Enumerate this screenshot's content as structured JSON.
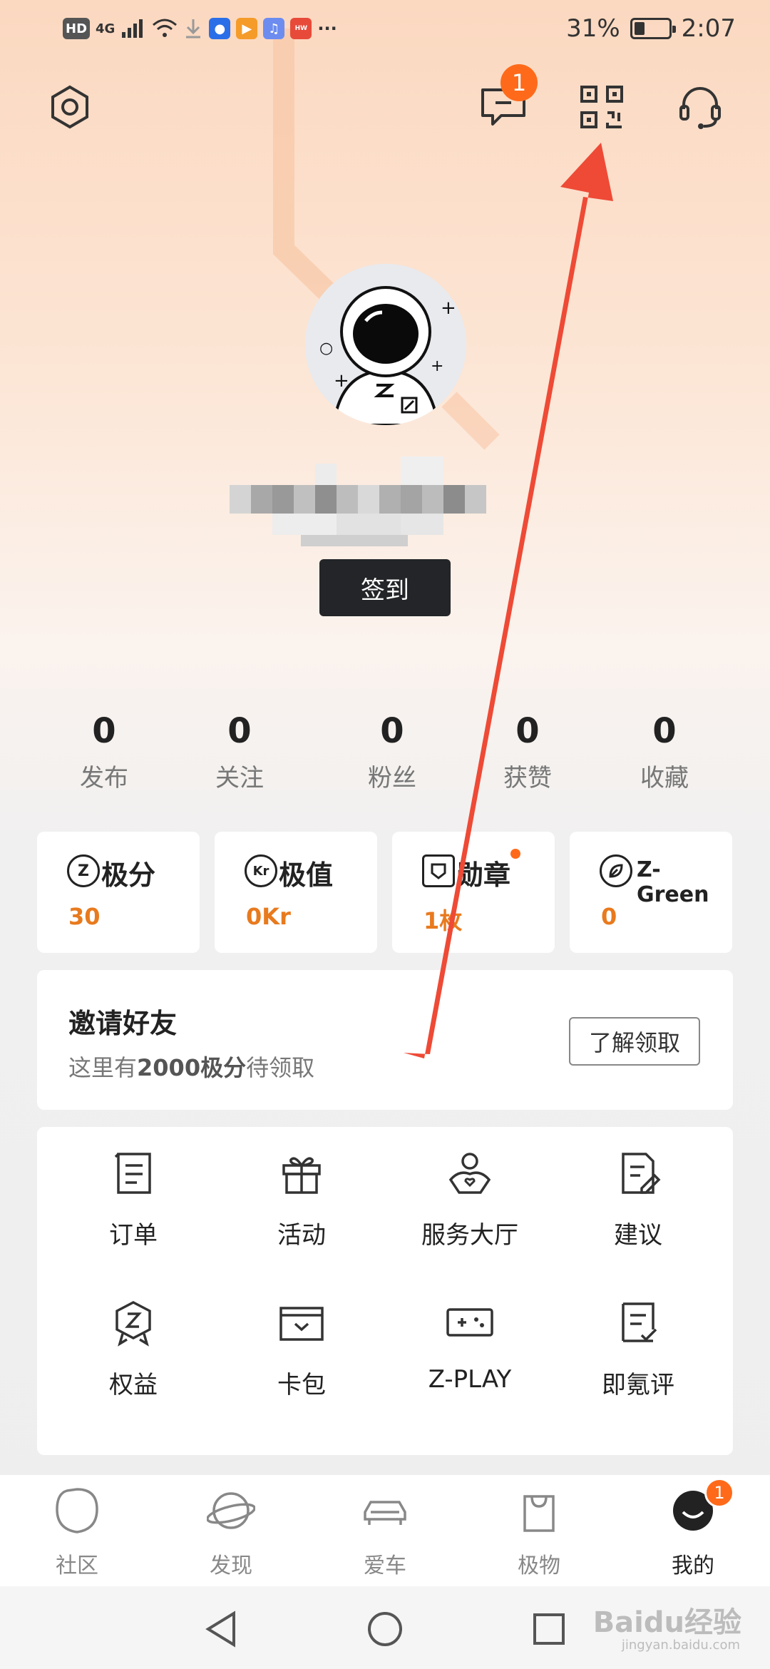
{
  "status_bar": {
    "left_labels": [
      "HD",
      "4G"
    ],
    "more": "···",
    "battery_percent": "31%",
    "battery_level": 0.31,
    "time": "2:07"
  },
  "header": {
    "message_badge": "1"
  },
  "profile": {
    "checkin_label": "签到"
  },
  "stats": [
    {
      "value": "0",
      "label": "发布"
    },
    {
      "value": "0",
      "label": "关注"
    },
    {
      "value": "0",
      "label": "粉丝"
    },
    {
      "value": "0",
      "label": "获赞"
    },
    {
      "value": "0",
      "label": "收藏"
    }
  ],
  "cards": [
    {
      "icon_text": "Z",
      "title": "极分",
      "value": "30"
    },
    {
      "icon_text": "Kr",
      "title": "极值",
      "value": "0Kr"
    },
    {
      "icon_text": "",
      "title": "勋章",
      "value": "1枚"
    },
    {
      "icon_text": "",
      "title": "Z-Green",
      "value": "0"
    }
  ],
  "invite": {
    "title": "邀请好友",
    "sub_prefix": "这里有",
    "sub_bold": "2000极分",
    "sub_suffix": "待领取",
    "button": "了解领取"
  },
  "services": [
    {
      "label": "订单",
      "icon": "order-icon"
    },
    {
      "label": "活动",
      "icon": "gift-icon"
    },
    {
      "label": "服务大厅",
      "icon": "service-hall-icon"
    },
    {
      "label": "建议",
      "icon": "feedback-icon"
    },
    {
      "label": "权益",
      "icon": "benefits-icon"
    },
    {
      "label": "卡包",
      "icon": "card-wallet-icon"
    },
    {
      "label": "Z-PLAY",
      "icon": "gamepad-icon"
    },
    {
      "label": "即氪评",
      "icon": "review-icon"
    }
  ],
  "bottom_nav": [
    {
      "label": "社区",
      "icon": "community-icon",
      "active": false
    },
    {
      "label": "发现",
      "icon": "planet-icon",
      "active": false
    },
    {
      "label": "爱车",
      "icon": "car-icon",
      "active": false
    },
    {
      "label": "极物",
      "icon": "shopping-bag-icon",
      "active": false
    },
    {
      "label": "我的",
      "icon": "profile-icon",
      "active": true,
      "badge": "1"
    }
  ],
  "watermark": {
    "text": "Baidu经验",
    "sub": "jingyan.baidu.com"
  },
  "colors": {
    "accent": "#ff6a1a",
    "value_orange": "#e87a1e",
    "annotation_arrow": "#ee4a36"
  }
}
